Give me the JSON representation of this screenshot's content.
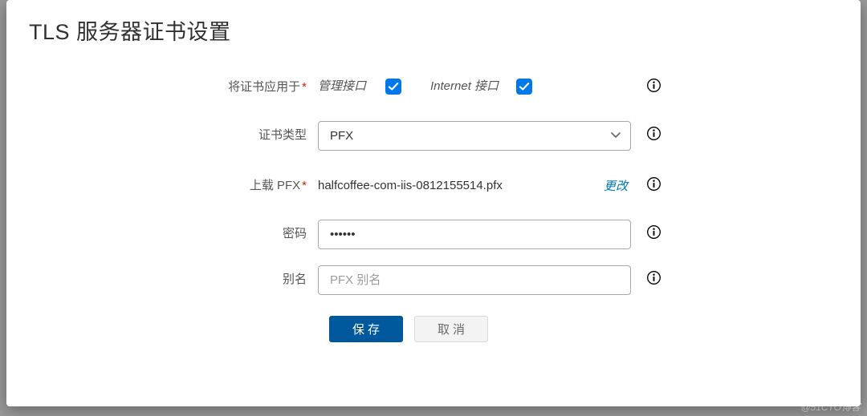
{
  "modal": {
    "title": "TLS 服务器证书设置"
  },
  "form": {
    "apply_to": {
      "label": "将证书应用于",
      "required_marker": "*",
      "options": {
        "management": {
          "label": "管理接口",
          "checked": true
        },
        "internet": {
          "label": "Internet 接口",
          "checked": true
        }
      }
    },
    "cert_type": {
      "label": "证书类型",
      "value": "PFX"
    },
    "upload_pfx": {
      "label": "上载 PFX",
      "required_marker": "*",
      "filename": "halfcoffee-com-iis-0812155514.pfx",
      "change_label": "更改"
    },
    "password": {
      "label": "密码",
      "value": "••••••"
    },
    "alias": {
      "label": "别名",
      "placeholder": "PFX 别名",
      "value": ""
    }
  },
  "buttons": {
    "save": "保存",
    "cancel": "取消"
  },
  "watermark": "@51CTO博客"
}
